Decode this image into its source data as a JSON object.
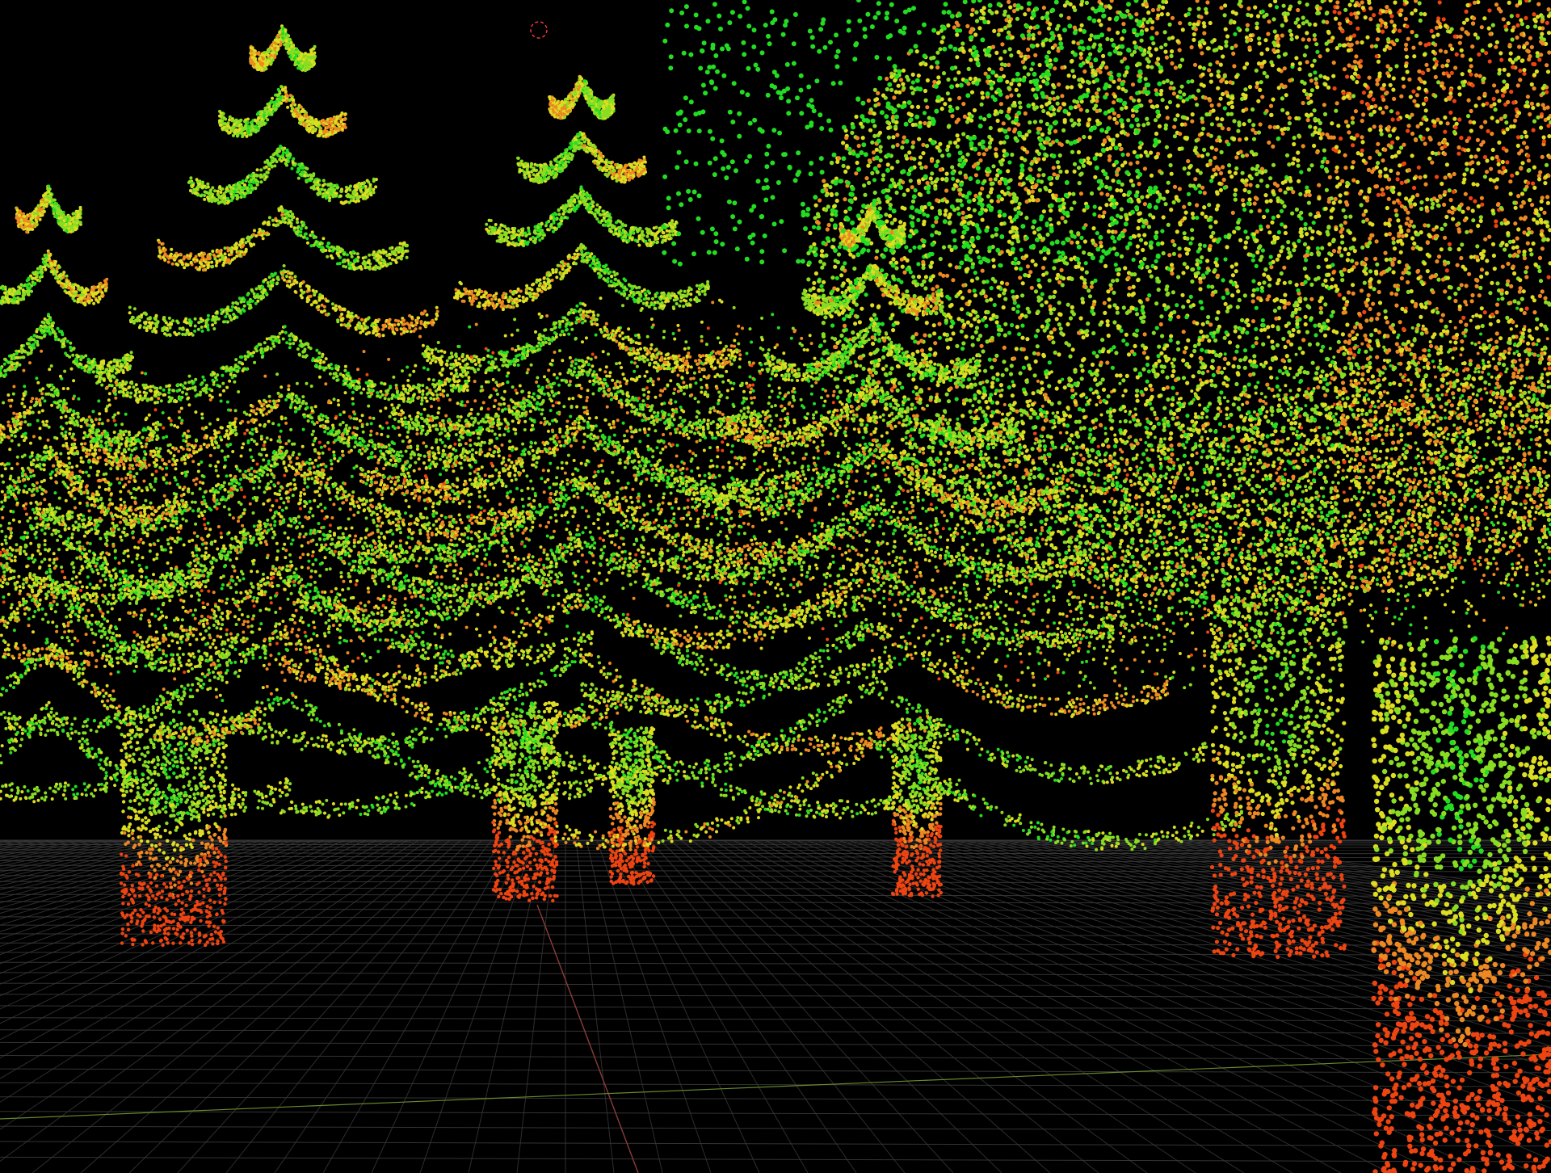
{
  "app": {
    "view_type": "3d-point-cloud-viewport",
    "background_color": "#000000"
  },
  "scene": {
    "subject": "forest-point-cloud",
    "tree_count": 7,
    "ground_grid": true,
    "grid_color": "#3a3a3a",
    "axis_colors": {
      "x_axis": "#8a3d3d",
      "y_axis": "#6b8a2e"
    },
    "point_color_scale": [
      "#22dd22",
      "#88dd22",
      "#dddd22",
      "#ee8822",
      "#ee4411"
    ]
  },
  "overlay": {
    "cursor_icon": "3d-cursor-icon",
    "cursor_color": "#ff3b3b"
  }
}
